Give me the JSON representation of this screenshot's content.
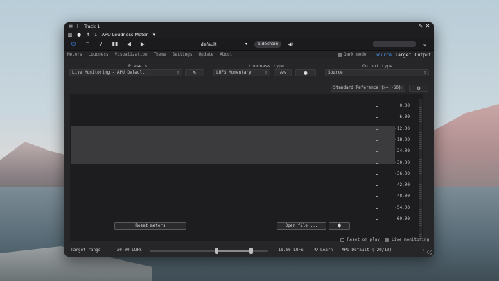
{
  "window": {
    "title": "Track 1"
  },
  "host": {
    "plugin_slot": "1 - APU Loudness Meter",
    "preset": "default",
    "sidechain_label": "Sidechain"
  },
  "menu": {
    "items": [
      "Meters",
      "Loudness",
      "Visualization",
      "Theme",
      "Settings",
      "Update",
      "About"
    ],
    "dark_mode_label": "Dark mode",
    "dark_mode_checked": true,
    "view_tabs": [
      "Source",
      "Target",
      "Output"
    ],
    "active_view_tab": "Source"
  },
  "panels": {
    "presets_heading": "Presets",
    "presets_value": "Live Monitoring - APU Default",
    "loudness_heading": "Loudness type",
    "loudness_value": "LUFS Momentary",
    "loudness_link_label": "oo",
    "output_heading": "Output type",
    "output_value": "Source",
    "reference_value": "Standard Reference (>= -60)"
  },
  "meter": {
    "scale": [
      "0.00",
      "-6.00",
      "-12.00",
      "-18.00",
      "-24.00",
      "-30.00",
      "-36.00",
      "-42.00",
      "-48.00",
      "-54.00",
      "-60.00"
    ],
    "band_top_db": -12,
    "band_bottom_db": -28,
    "reset_meters_label": "Reset meters",
    "open_file_label": "Open file ..."
  },
  "footer": {
    "reset_on_play_label": "Reset on play",
    "reset_on_play_checked": false,
    "live_monitoring_label": "Live monitoring",
    "live_monitoring_checked": true,
    "target_range_label": "Target range",
    "range_low": "-30.00 LUFS",
    "range_high": "-10.00 LUFS",
    "range_low_fraction": 0.57,
    "range_high_fraction": 0.86,
    "learn_label": "Learn",
    "target_preset": "APU Default (-20/10)"
  },
  "colors": {
    "accent": "#4aa1ff",
    "power": "#3e8ef7",
    "panel_bg": "#262628"
  }
}
